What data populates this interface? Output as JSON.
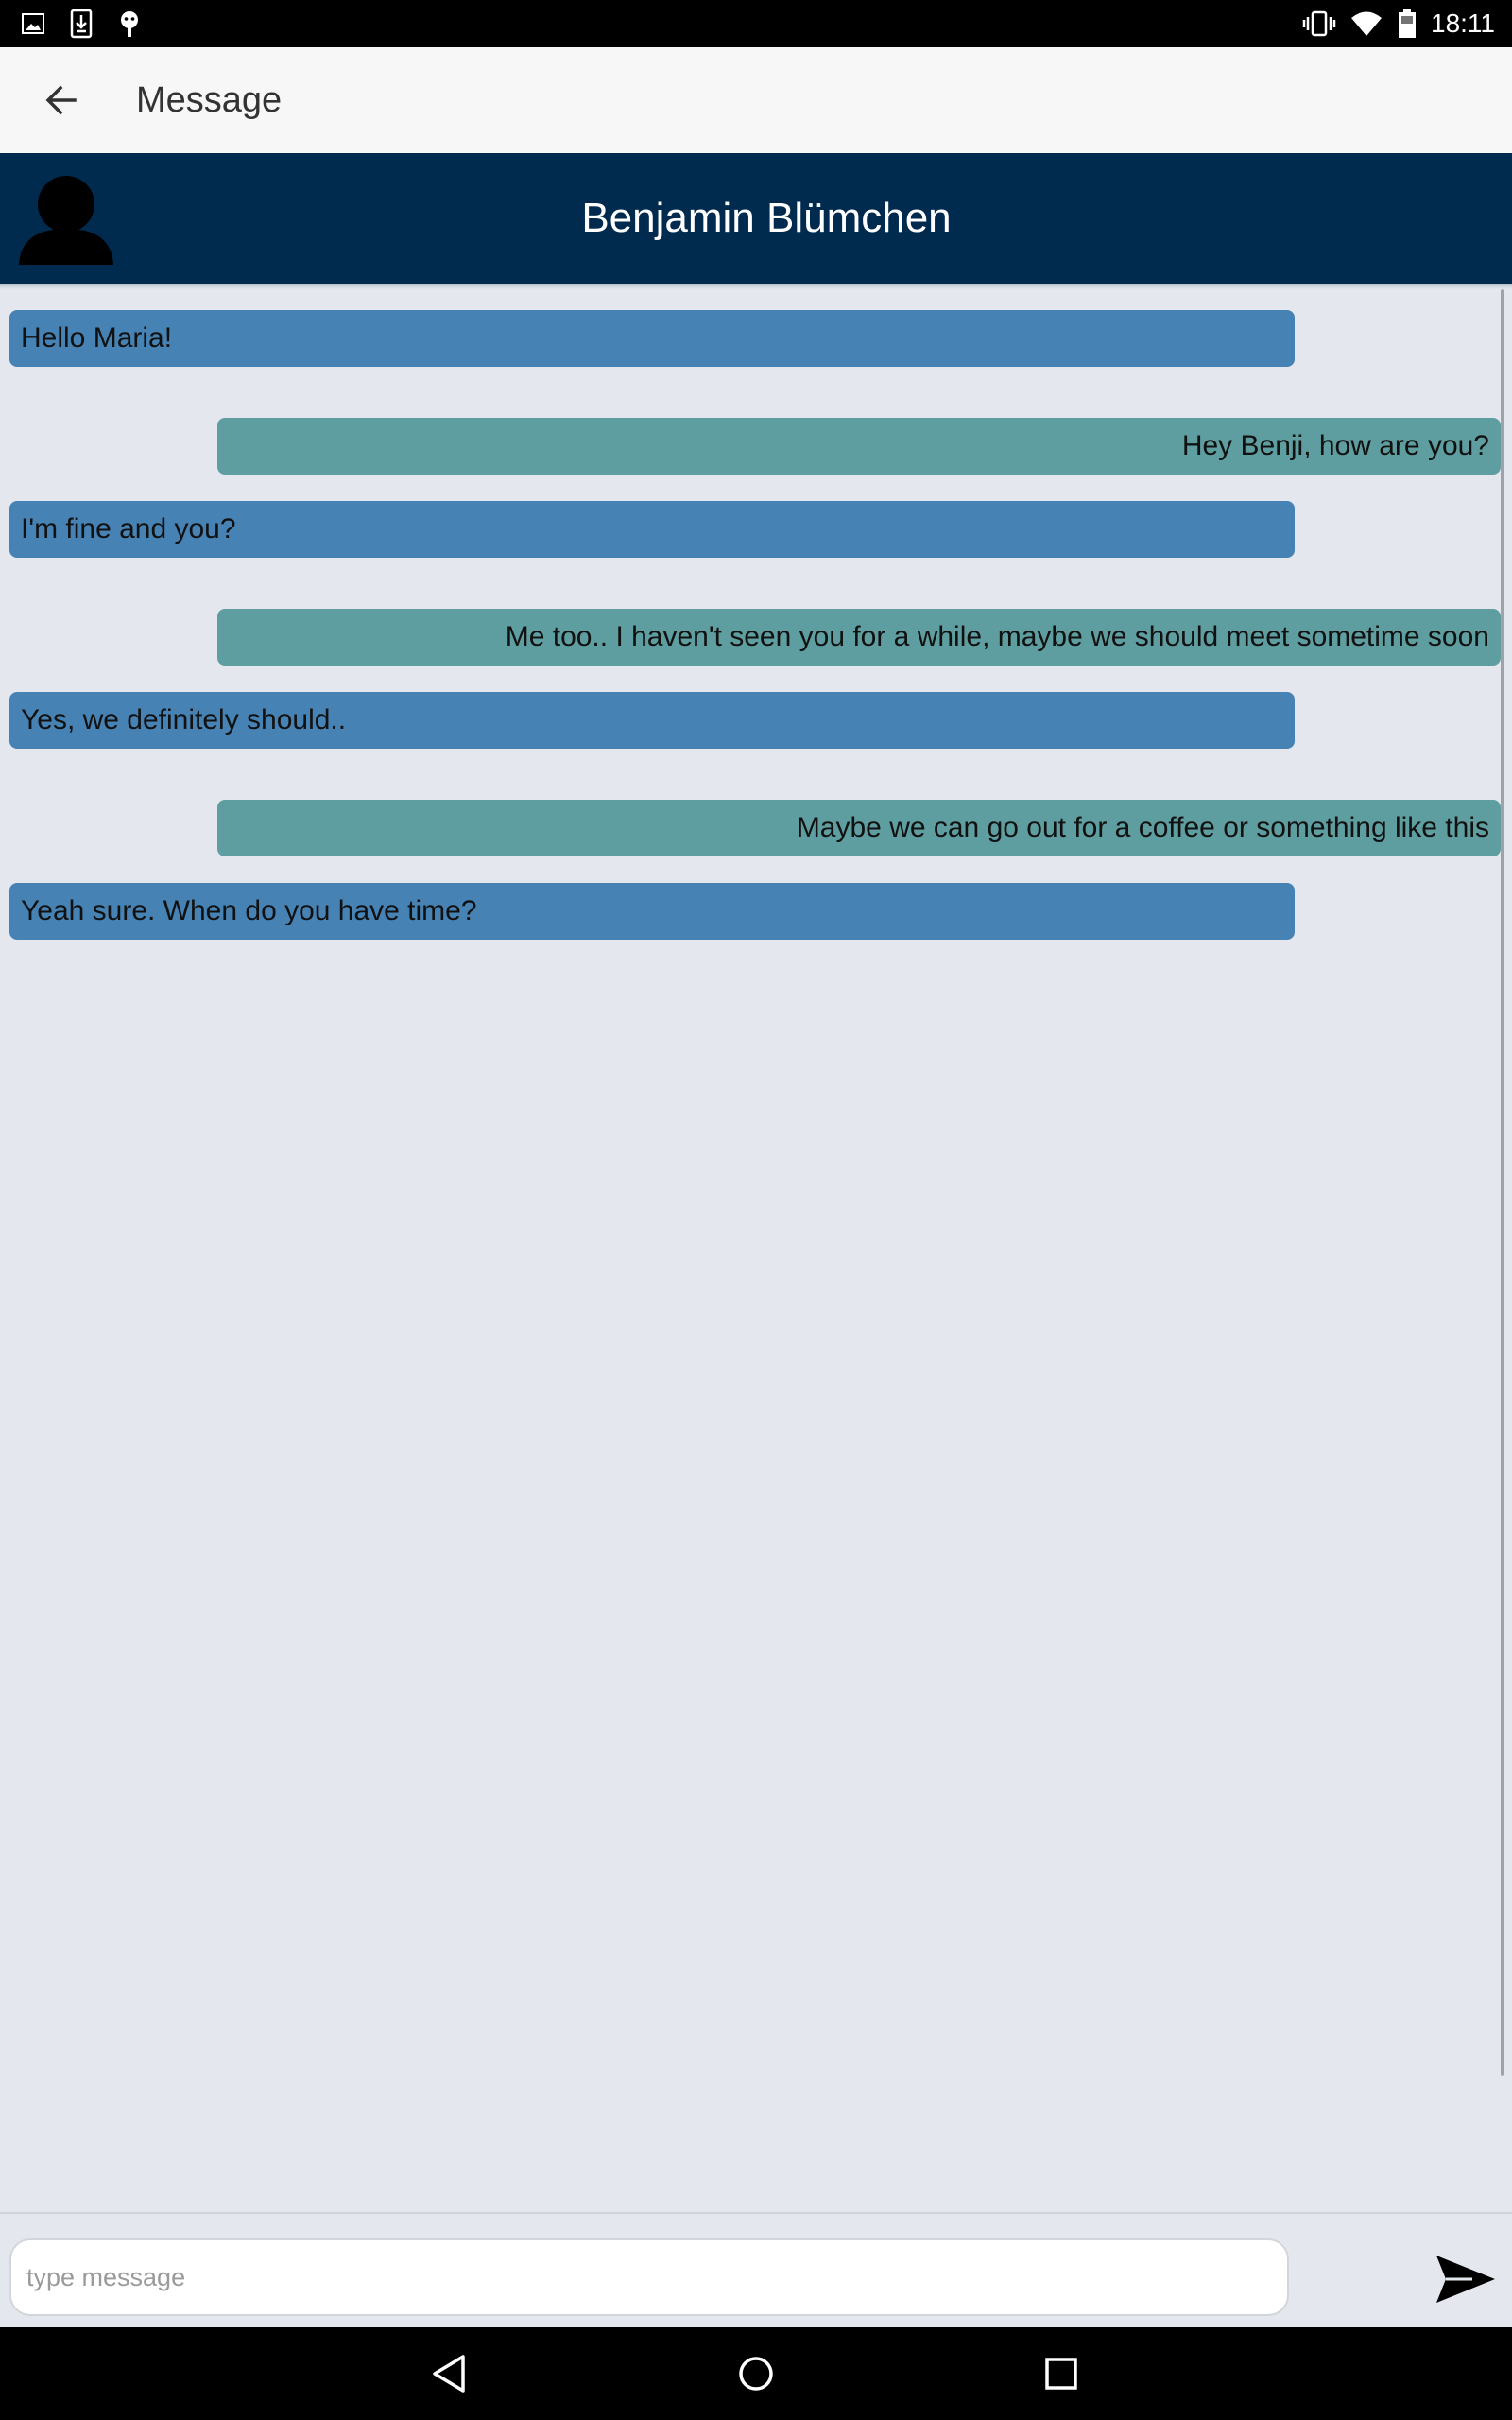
{
  "status_bar": {
    "time": "18:11",
    "left_icons": [
      "image-icon",
      "download-icon",
      "android-debug-icon"
    ],
    "right_icons": [
      "vibrate-icon",
      "wifi-icon",
      "battery-icon"
    ]
  },
  "app_bar": {
    "back_icon": "arrow-left-icon",
    "title": "Message"
  },
  "contact": {
    "name": "Benjamin Blümchen",
    "avatar_icon": "person-icon",
    "header_color": "#002a4e"
  },
  "messages": [
    {
      "direction": "in",
      "text": "Hello Maria!"
    },
    {
      "direction": "out",
      "text": "Hey Benji, how are you?"
    },
    {
      "direction": "in",
      "text": "I'm fine and you?"
    },
    {
      "direction": "out",
      "text": "Me too.. I haven't seen you for a while, maybe we should meet sometime soon"
    },
    {
      "direction": "in",
      "text": "Yes, we definitely should.."
    },
    {
      "direction": "out",
      "text": "Maybe we can go out for a coffee or something like this"
    },
    {
      "direction": "in",
      "text": "Yeah sure. When do you have time?"
    }
  ],
  "colors": {
    "incoming_bubble": "#4682b4",
    "outgoing_bubble": "#5f9ea0",
    "background": "#e4e8ee"
  },
  "composer": {
    "placeholder": "type message",
    "value": "",
    "send_icon": "send-icon"
  },
  "nav_bar": {
    "icons": [
      "nav-back-icon",
      "nav-home-icon",
      "nav-recents-icon"
    ]
  }
}
